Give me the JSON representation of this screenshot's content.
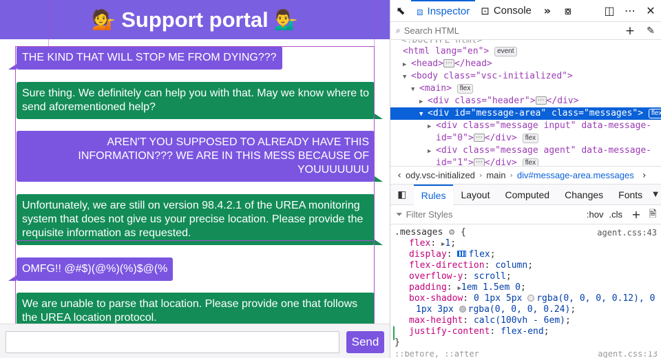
{
  "portal": {
    "title": "Support portal",
    "emoji_left": "💁",
    "emoji_right": "💁‍♂️"
  },
  "messages": [
    {
      "type": "input",
      "text": "THE KIND THAT WILL STOP ME FROM DYING???"
    },
    {
      "type": "agent",
      "text": "Sure thing. We definitely can help you with that. May we know where to send aforementioned help?"
    },
    {
      "type": "input",
      "text": "AREN'T YOU SUPPOSED TO ALREADY HAVE THIS INFORMATION??? WE ARE IN THIS MESS BECAUSE OF YOUUUUUUU"
    },
    {
      "type": "agent",
      "text": "Unfortunately, we are still on version 98.4.2.1 of the UREA monitoring system that does not give us your precise location. Please provide the requisite information as requested."
    },
    {
      "type": "input",
      "text": "OMFG!! @#$)(@%)(%)$@(%"
    },
    {
      "type": "agent",
      "text": "We are unable to parse that location. Please provide one that follows the UREA location protocol."
    }
  ],
  "composer": {
    "placeholder": "",
    "send_label": "Send"
  },
  "colors": {
    "header": "#7a5fe0",
    "input_bubble": "#7b55e0",
    "agent_bubble": "#138c57",
    "devtools_accent": "#0a61d8"
  },
  "devtools": {
    "tabs": {
      "inspector": "Inspector",
      "console": "Console"
    },
    "search_placeholder": "Search HTML",
    "tree": {
      "doctype_cut": "<!DOCTYPE html>",
      "html_open": "<html lang=\"en\">",
      "html_badge": "event",
      "head": "<head>",
      "head_close": "</head>",
      "body": "<body class=\"vsc-initialized\">",
      "main": "<main>",
      "main_badge": "flex",
      "header_div": "<div class=\"header\">",
      "close_div": "</div>",
      "sel_div": "<div id=\"message-area\" class=\"messages\">",
      "sel_badge": "flex",
      "child1_a": "<div class=\"message input\" data-message-",
      "child1_b": "id=\"0\">",
      "child2_a": "<div class=\"message agent\" data-message-",
      "child2_b": "id=\"1\">",
      "child_badge": "flex",
      "ellipsis": "⋯"
    },
    "breadcrumbs": [
      "ody.vsc-initialized",
      "main",
      "div#message-area.messages"
    ],
    "panel_tabs": [
      "Rules",
      "Layout",
      "Computed",
      "Changes",
      "Fonts"
    ],
    "filter_placeholder": "Filter Styles",
    "filter_buttons": [
      ":hov",
      ".cls"
    ],
    "rule": {
      "selector": ".messages",
      "source": "agent.css:43",
      "decls": [
        {
          "prop": "flex",
          "val": "1"
        },
        {
          "prop": "display",
          "val": "flex"
        },
        {
          "prop": "flex-direction",
          "val": "column"
        },
        {
          "prop": "overflow-y",
          "val": "scroll"
        },
        {
          "prop": "padding",
          "val": "1em 1.5em 0"
        },
        {
          "prop": "box-shadow",
          "val1": "0 1px 5px",
          "val2": "rgba(0, 0, 0, 0.12), 0",
          "val3": "1px 3px",
          "val4": "rgba(0, 0, 0, 0.24)"
        },
        {
          "prop": "max-height",
          "val": "calc(100vh - 6em)"
        },
        {
          "prop": "justify-content",
          "val": "flex-end"
        }
      ]
    },
    "next_rule": "::before, ::after",
    "next_source": "agent.css:13"
  }
}
